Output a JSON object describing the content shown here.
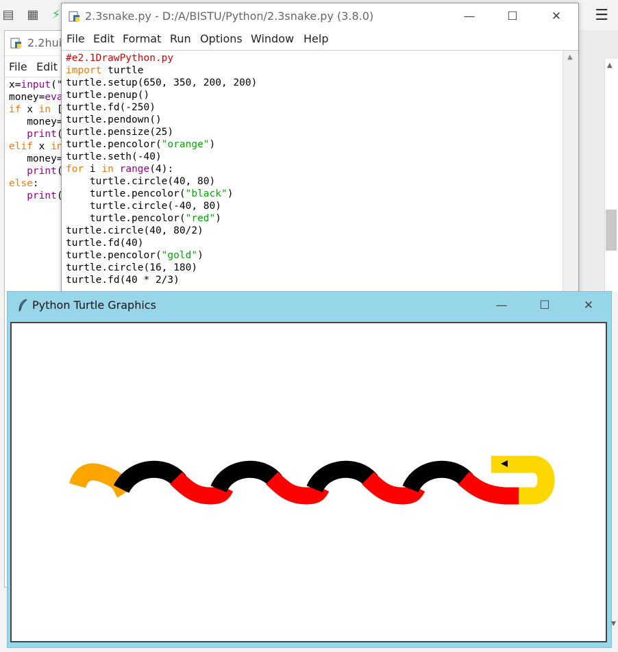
{
  "desktop": {
    "menu_glyph": "☰",
    "taskbar_icons": [
      "window-icon",
      "grid-icon",
      "bolt-icon"
    ]
  },
  "back_window": {
    "title": "2.2hui",
    "menu": [
      "File",
      "Edit"
    ],
    "code_lines": [
      [
        {
          "c": "df",
          "t": "x="
        },
        {
          "c": "bi",
          "t": "input"
        },
        {
          "c": "df",
          "t": "(\""
        }
      ],
      [
        {
          "c": "df",
          "t": "money="
        },
        {
          "c": "bi",
          "t": "eva"
        }
      ],
      [
        {
          "c": "kw",
          "t": "if"
        },
        {
          "c": "df",
          "t": " x "
        },
        {
          "c": "kw",
          "t": "in"
        },
        {
          "c": "df",
          "t": " ["
        }
      ],
      [
        {
          "c": "df",
          "t": "   money="
        }
      ],
      [
        {
          "c": "df",
          "t": "   "
        },
        {
          "c": "bi",
          "t": "print"
        },
        {
          "c": "df",
          "t": "("
        }
      ],
      [
        {
          "c": "kw",
          "t": "elif"
        },
        {
          "c": "df",
          "t": " x "
        },
        {
          "c": "kw",
          "t": "in"
        }
      ],
      [
        {
          "c": "df",
          "t": "   money="
        }
      ],
      [
        {
          "c": "df",
          "t": "   "
        },
        {
          "c": "bi",
          "t": "print"
        },
        {
          "c": "df",
          "t": "("
        }
      ],
      [
        {
          "c": "kw",
          "t": "else"
        },
        {
          "c": "df",
          "t": ":"
        }
      ],
      [
        {
          "c": "df",
          "t": "   "
        },
        {
          "c": "bi",
          "t": "print"
        },
        {
          "c": "df",
          "t": "("
        }
      ]
    ]
  },
  "editor": {
    "title": "2.3snake.py - D:/A/BISTU/Python/2.3snake.py (3.8.0)",
    "controls": {
      "minimize": "—",
      "maximize": "☐",
      "close": "✕"
    },
    "menu": [
      "File",
      "Edit",
      "Format",
      "Run",
      "Options",
      "Window",
      "Help"
    ],
    "code_lines": [
      [
        {
          "c": "cm",
          "t": "#e2.1DrawPython.py"
        }
      ],
      [
        {
          "c": "kw",
          "t": "import"
        },
        {
          "c": "df",
          "t": " turtle"
        }
      ],
      [
        {
          "c": "df",
          "t": "turtle.setup(650, 350, 200, 200)"
        }
      ],
      [
        {
          "c": "df",
          "t": "turtle.penup()"
        }
      ],
      [
        {
          "c": "df",
          "t": "turtle.fd(-250)"
        }
      ],
      [
        {
          "c": "df",
          "t": "turtle.pendown()"
        }
      ],
      [
        {
          "c": "df",
          "t": "turtle.pensize(25)"
        }
      ],
      [
        {
          "c": "df",
          "t": "turtle.pencolor("
        },
        {
          "c": "st",
          "t": "\"orange\""
        },
        {
          "c": "df",
          "t": ")"
        }
      ],
      [
        {
          "c": "df",
          "t": "turtle.seth(-40)"
        }
      ],
      [
        {
          "c": "kw",
          "t": "for"
        },
        {
          "c": "df",
          "t": " i "
        },
        {
          "c": "kw",
          "t": "in"
        },
        {
          "c": "df",
          "t": " "
        },
        {
          "c": "bi",
          "t": "range"
        },
        {
          "c": "df",
          "t": "(4):"
        }
      ],
      [
        {
          "c": "df",
          "t": "    turtle.circle(40, 80)"
        }
      ],
      [
        {
          "c": "df",
          "t": "    turtle.pencolor("
        },
        {
          "c": "st",
          "t": "\"black\""
        },
        {
          "c": "df",
          "t": ")"
        }
      ],
      [
        {
          "c": "df",
          "t": "    turtle.circle(-40, 80)"
        }
      ],
      [
        {
          "c": "df",
          "t": "    turtle.pencolor("
        },
        {
          "c": "st",
          "t": "\"red\""
        },
        {
          "c": "df",
          "t": ")"
        }
      ],
      [
        {
          "c": "df",
          "t": "turtle.circle(40, 80/2)"
        }
      ],
      [
        {
          "c": "df",
          "t": "turtle.fd(40)"
        }
      ],
      [
        {
          "c": "df",
          "t": "turtle.pencolor("
        },
        {
          "c": "st",
          "t": "\"gold\""
        },
        {
          "c": "df",
          "t": ")"
        }
      ],
      [
        {
          "c": "df",
          "t": "turtle.circle(16, 180)"
        }
      ],
      [
        {
          "c": "df",
          "t": "turtle.fd(40 * 2/3)"
        }
      ]
    ]
  },
  "turtle_window": {
    "title": "Python Turtle Graphics",
    "controls": {
      "minimize": "—",
      "maximize": "☐",
      "close": "✕"
    },
    "snake_colors": {
      "tail": "#ffa500",
      "black": "#000000",
      "red": "#ff0000",
      "head": "#ffd700"
    }
  }
}
